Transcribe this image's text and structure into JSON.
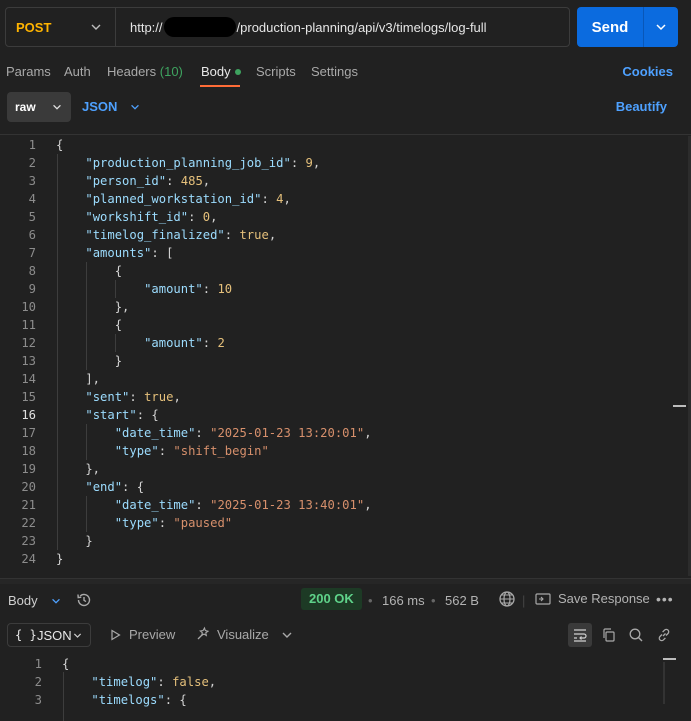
{
  "request": {
    "method": "POST",
    "url_prefix": "http://",
    "url_suffix": "/production-planning/api/v3/timelogs/log-full",
    "send_label": "Send"
  },
  "req_tabs": {
    "params": "Params",
    "auth": "Auth",
    "headers": "Headers",
    "headers_count": "(10)",
    "body": "Body",
    "scripts": "Scripts",
    "settings": "Settings",
    "cookies": "Cookies"
  },
  "body_options": {
    "mode": "raw",
    "format": "JSON",
    "beautify": "Beautify"
  },
  "editor": {
    "current_line": 16,
    "lines": [
      "{",
      "    \"production_planning_job_id\": 9,",
      "    \"person_id\": 485,",
      "    \"planned_workstation_id\": 4,",
      "    \"workshift_id\": 0,",
      "    \"timelog_finalized\": true,",
      "    \"amounts\": [",
      "        {",
      "            \"amount\": 10",
      "        },",
      "        {",
      "            \"amount\": 2",
      "        }",
      "    ],",
      "    \"sent\": true,",
      "    \"start\": {",
      "        \"date_time\": \"2025-01-23 13:20:01\",",
      "        \"type\": \"shift_begin\"",
      "    },",
      "    \"end\": {",
      "        \"date_time\": \"2025-01-23 13:40:01\",",
      "        \"type\": \"paused\"",
      "    }",
      "}"
    ]
  },
  "response": {
    "body_label": "Body",
    "status": "200 OK",
    "time": "166 ms",
    "size": "562 B",
    "save_label": "Save Response",
    "format_label": "JSON",
    "format_icon": "{ }",
    "preview_label": "Preview",
    "visualize_label": "Visualize",
    "lines": [
      "{",
      "    \"timelog\": false,",
      "    \"timelogs\": {"
    ]
  },
  "colors": {
    "accent": "#ff6c37",
    "link": "#4ea1ff",
    "send": "#0b6bdf",
    "method": "#ffb400",
    "status_ok": "#5fd38a"
  }
}
